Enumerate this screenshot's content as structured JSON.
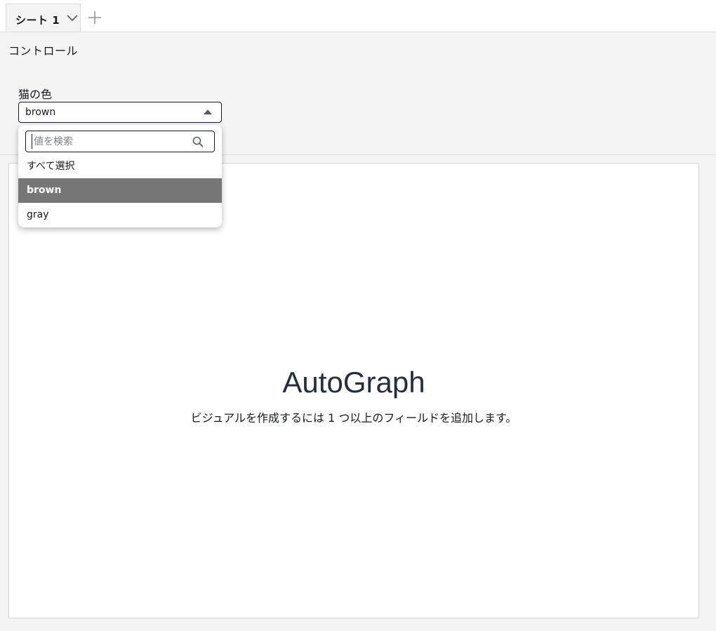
{
  "tabs": [
    {
      "label": "シート 1"
    }
  ],
  "control_section": {
    "heading": "コントロール"
  },
  "filter": {
    "label": "猫の色",
    "selected_value": "brown",
    "search_placeholder": "値を検索",
    "options": [
      {
        "label": "すべて選択",
        "selected": false
      },
      {
        "label": "brown",
        "selected": true
      },
      {
        "label": "gray",
        "selected": false
      }
    ]
  },
  "visual": {
    "title": "AutoGraph",
    "hint": "ビジュアルを作成するには 1 つ以上のフィールドを追加します。"
  },
  "colors": {
    "selected_option_bg": "#777777",
    "page_bg": "#f4f4f4",
    "text": "#16191f"
  }
}
